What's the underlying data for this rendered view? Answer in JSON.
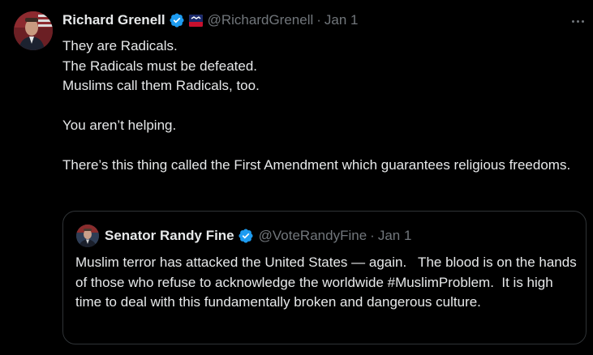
{
  "tweet": {
    "display_name": "Richard Grenell",
    "verified_icon": "verified-badge-icon",
    "affiliate_icon": "cpac-affiliate-icon",
    "handle": "@RichardGrenell",
    "separator": "·",
    "date": "Jan 1",
    "more_icon": "more-options-icon",
    "lines": [
      "They are Radicals.",
      "The Radicals must be defeated.",
      "Muslims call them Radicals, too."
    ],
    "line2": "You aren’t helping.",
    "line3": "There’s this thing called the First Amendment which guarantees religious freedoms."
  },
  "quote": {
    "display_name": "Senator Randy Fine",
    "verified_icon": "verified-badge-icon",
    "handle": "@VoteRandyFine",
    "separator": "·",
    "date": "Jan 1",
    "text": "Muslim terror has attacked the United States — again.   The blood is on the hands of those who refuse to acknowledge the worldwide #MuslimProblem.  It is high time to deal with this fundamentally broken and dangerous culture."
  },
  "colors": {
    "background": "#000000",
    "text": "#e7e9ea",
    "muted": "#71767b",
    "verified": "#1d9bf0",
    "border": "#2f3336"
  }
}
